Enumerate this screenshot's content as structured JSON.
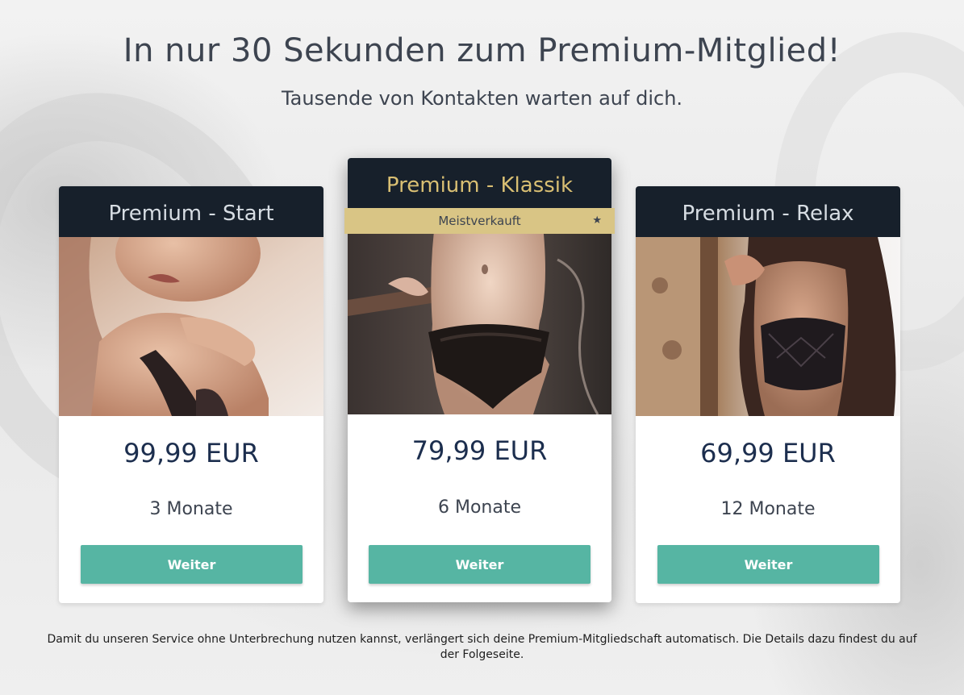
{
  "header": {
    "title": "In nur 30 Sekunden zum Premium-Mitglied!",
    "subtitle": "Tausende von Kontakten warten auf dich."
  },
  "plans": [
    {
      "name": "Premium - Start",
      "price": "99,99 EUR",
      "duration": "3 Monate",
      "button_label": "Weiter"
    },
    {
      "name": "Premium - Klassik",
      "badge": "Meistverkauft",
      "badge_icon": "star-icon",
      "price": "79,99 EUR",
      "duration": "6 Monate",
      "button_label": "Weiter"
    },
    {
      "name": "Premium - Relax",
      "price": "69,99 EUR",
      "duration": "12 Monate",
      "button_label": "Weiter"
    }
  ],
  "footnote": "Damit du unseren Service ohne Unterbrechung nutzen kannst, verlängert sich deine Premium-Mitgliedschaft automatisch. Die Details dazu findest du auf der Folgeseite.",
  "colors": {
    "header_bg": "#17202b",
    "featured_title": "#d9bf73",
    "badge_bg": "#d9c585",
    "button": "#56b5a3",
    "price": "#1c2e4e"
  }
}
